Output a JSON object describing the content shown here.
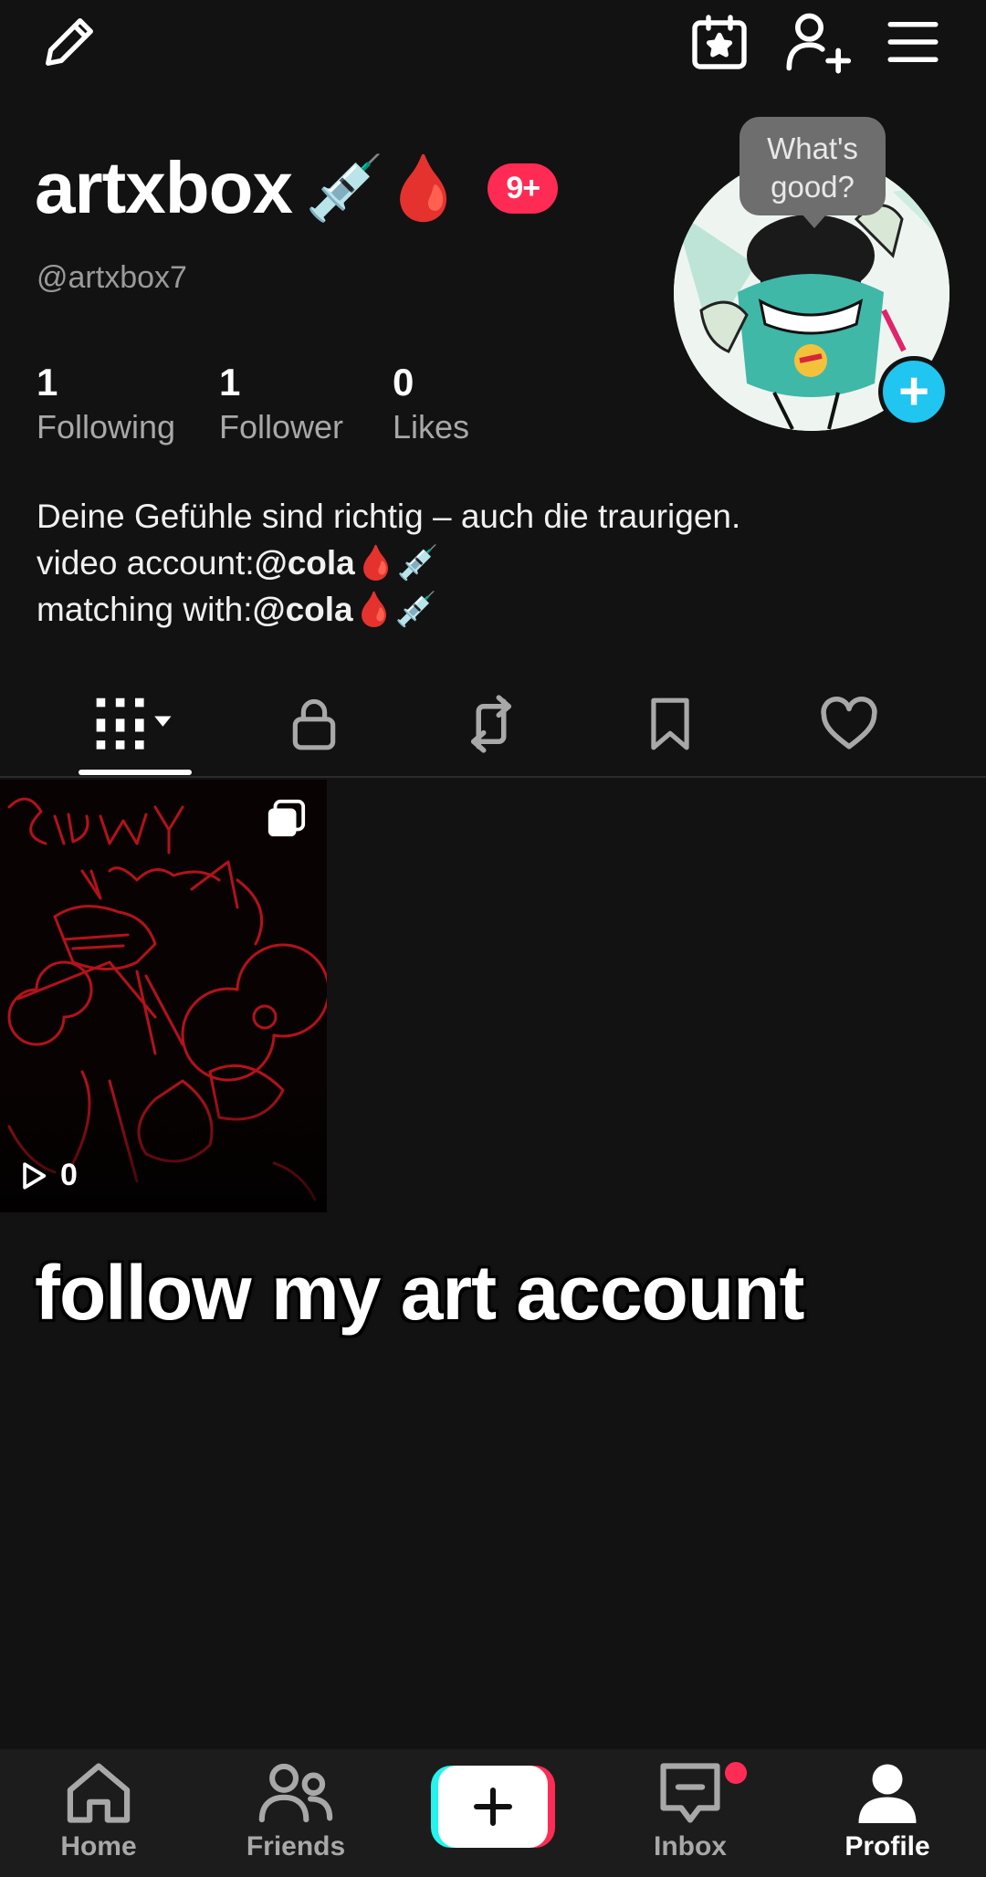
{
  "topbar": {
    "edit_icon": "pencil-icon",
    "events_icon": "calendar-star-icon",
    "add_friend_icon": "add-person-icon",
    "menu_icon": "hamburger-menu-icon"
  },
  "profile": {
    "display_name": "artxbox",
    "name_emojis": "💉🩸",
    "badge": "9+",
    "handle": "@artxbox7",
    "avatar_bubble": "What's good?",
    "stats": [
      {
        "value": "1",
        "label": "Following"
      },
      {
        "value": "1",
        "label": "Follower"
      },
      {
        "value": "0",
        "label": "Likes"
      }
    ],
    "bio": {
      "line1": "Deine Gefühle sind richtig – auch die traurigen.",
      "line2_prefix": "video account:",
      "line2_mention": "@cola",
      "line2_emojis": "🩸💉",
      "line3_prefix": "matching with:",
      "line3_mention": "@cola",
      "line3_emojis": "🩸💉"
    }
  },
  "tabs": [
    {
      "name": "videos",
      "icon": "grid-icon"
    },
    {
      "name": "private",
      "icon": "lock-icon"
    },
    {
      "name": "reposts",
      "icon": "repost-icon"
    },
    {
      "name": "favorites",
      "icon": "bookmark-icon"
    },
    {
      "name": "liked",
      "icon": "heart-icon"
    }
  ],
  "video": {
    "views": "0",
    "thumb_title": "Snowy Anesthesia"
  },
  "caption": "follow my art account",
  "bottom_nav": [
    {
      "label": "Home",
      "icon": "home-icon"
    },
    {
      "label": "Friends",
      "icon": "friends-icon"
    },
    {
      "label": "",
      "icon": "plus-icon"
    },
    {
      "label": "Inbox",
      "icon": "inbox-icon"
    },
    {
      "label": "Profile",
      "icon": "profile-icon",
      "active": true
    }
  ],
  "colors": {
    "background": "#121212",
    "badge": "#ff2b55",
    "avatar_plus": "#20c5f0",
    "create_cyan": "#25f4ee",
    "create_pink": "#fe2c55"
  }
}
